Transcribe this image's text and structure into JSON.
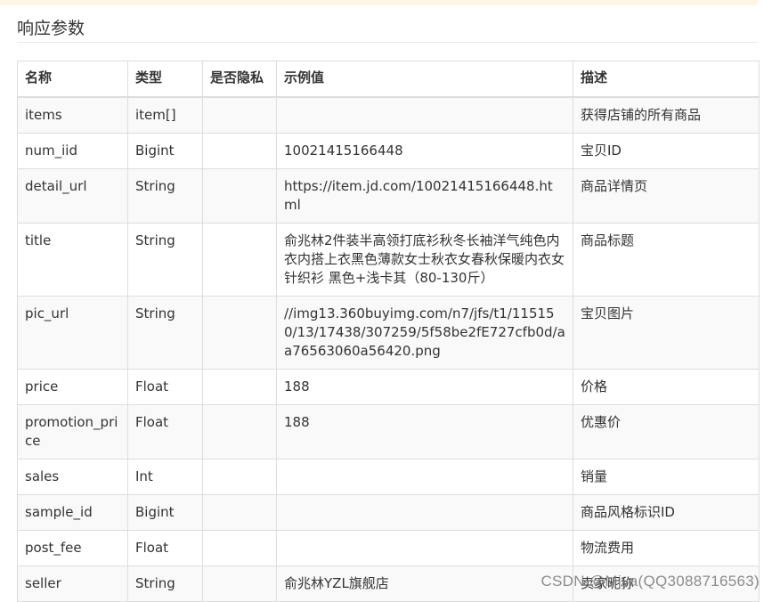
{
  "section_title": "响应参数",
  "table": {
    "headers": [
      "名称",
      "类型",
      "是否隐私",
      "示例值",
      "描述"
    ],
    "rows": [
      [
        "items",
        "item[]",
        "",
        "",
        "获得店铺的所有商品"
      ],
      [
        "num_iid",
        "Bigint",
        "",
        "10021415166448",
        "宝贝ID"
      ],
      [
        "detail_url",
        "String",
        "",
        "https://item.jd.com/10021415166448.html",
        "商品详情页"
      ],
      [
        "title",
        "String",
        "",
        "俞兆林2件装半高领打底衫秋冬长袖洋气纯色内衣内搭上衣黑色薄款女士秋衣女春秋保暖内衣女针织衫 黑色+浅卡其（80-130斤）",
        "商品标题"
      ],
      [
        "pic_url",
        "String",
        "",
        "//img13.360buyimg.com/n7/jfs/t1/115150/13/17438/307259/5f58be2fE727cfb0d/aa76563060a56420.png",
        "宝贝图片"
      ],
      [
        "price",
        "Float",
        "",
        "188",
        "价格"
      ],
      [
        "promotion_price",
        "Float",
        "",
        "188",
        "优惠价"
      ],
      [
        "sales",
        "Int",
        "",
        "",
        "销量"
      ],
      [
        "sample_id",
        "Bigint",
        "",
        "",
        "商品风格标识ID"
      ],
      [
        "post_fee",
        "Float",
        "",
        "",
        "物流费用"
      ],
      [
        "seller",
        "String",
        "",
        "俞兆林YZL旗舰店",
        "卖家昵称"
      ]
    ]
  },
  "watermark": "CSDN @Miya(QQ3088716563)"
}
